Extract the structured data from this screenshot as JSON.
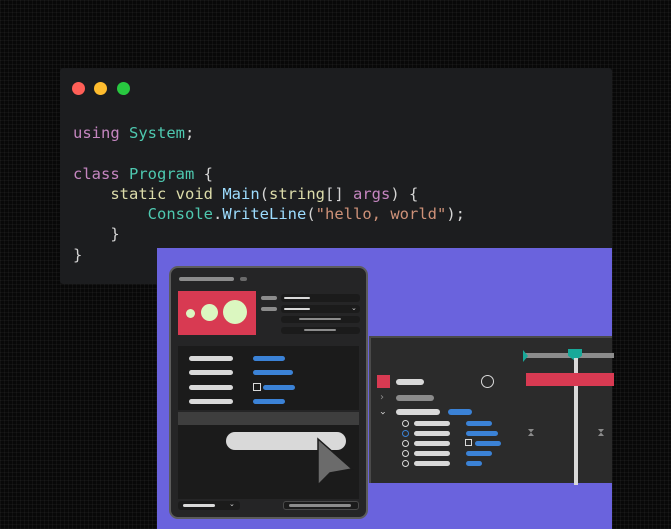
{
  "window": {
    "traffic_lights": [
      {
        "name": "close-dot",
        "color": "#ff5f57"
      },
      {
        "name": "minimize-dot",
        "color": "#febc2e"
      },
      {
        "name": "zoom-dot",
        "color": "#28c840"
      }
    ]
  },
  "code": {
    "language": "csharp",
    "lines": [
      [
        {
          "t": "using ",
          "c": "#c586c0"
        },
        {
          "t": "System",
          "c": "#4ec9b0"
        },
        {
          "t": ";",
          "c": "#d4d4d4"
        }
      ],
      [],
      [
        {
          "t": "class ",
          "c": "#c586c0"
        },
        {
          "t": "Program",
          "c": "#4ec9b0"
        },
        {
          "t": " {",
          "c": "#d4d4d4"
        }
      ],
      [
        {
          "t": "    static ",
          "c": "#dcdcaa"
        },
        {
          "t": "void ",
          "c": "#dcdcaa"
        },
        {
          "t": "Main",
          "c": "#9cdcfe"
        },
        {
          "t": "(",
          "c": "#d4d4d4"
        },
        {
          "t": "string",
          "c": "#dcdcaa"
        },
        {
          "t": "[] ",
          "c": "#d4d4d4"
        },
        {
          "t": "args",
          "c": "#c586c0"
        },
        {
          "t": ") {",
          "c": "#d4d4d4"
        }
      ],
      [
        {
          "t": "        Console",
          "c": "#4ec9b0"
        },
        {
          "t": ".",
          "c": "#d4d4d4"
        },
        {
          "t": "WriteLine",
          "c": "#9cdcfe"
        },
        {
          "t": "(",
          "c": "#d4d4d4"
        },
        {
          "t": "\"hello, world\"",
          "c": "#ce9178"
        },
        {
          "t": ");",
          "c": "#d4d4d4"
        }
      ],
      [
        {
          "t": "    }",
          "c": "#d4d4d4"
        }
      ],
      [
        {
          "t": "}",
          "c": "#d4d4d4"
        }
      ]
    ]
  },
  "illustration": {
    "background": "#6a63dd",
    "accent_red": "#d83a52",
    "accent_blue": "#3b82d6",
    "accent_teal": "#18a999",
    "circle_green": "#dbf7c0",
    "icons": {
      "cursor": "cursor-arrow-icon",
      "expand_closed": "chevron-right-icon",
      "expand_open": "chevron-down-icon",
      "dropdown": "chevron-down-icon",
      "keyframe": "hourglass-icon"
    }
  }
}
